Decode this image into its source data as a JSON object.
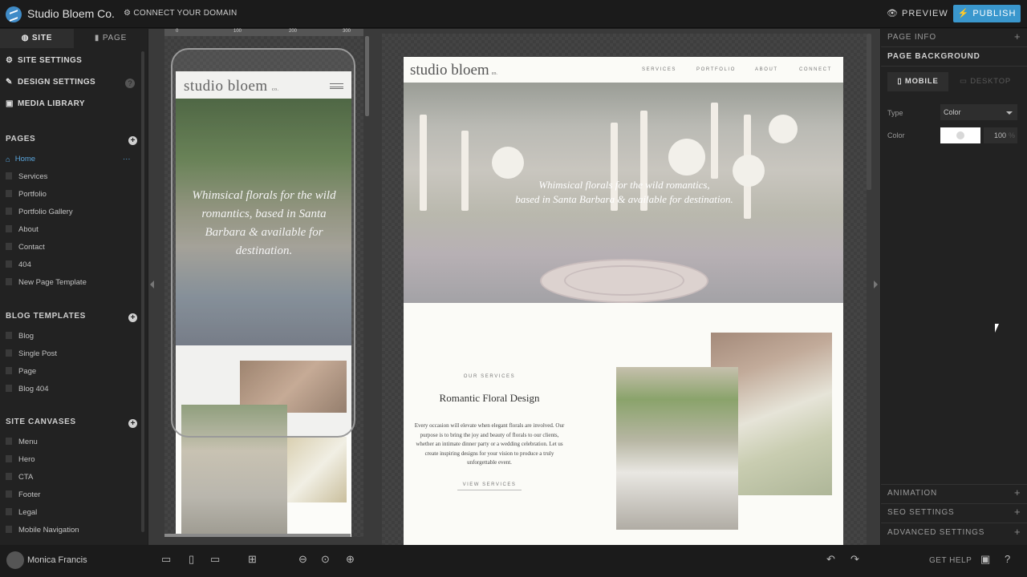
{
  "topbar": {
    "site_title": "Studio Bloem Co.",
    "connect_domain": "CONNECT YOUR DOMAIN",
    "preview": "PREVIEW",
    "publish": "PUBLISH"
  },
  "leftbar": {
    "tabs": [
      "SITE",
      "PAGE"
    ],
    "menu": [
      "SITE SETTINGS",
      "DESIGN SETTINGS",
      "MEDIA LIBRARY"
    ],
    "pages_header": "PAGES",
    "pages": [
      "Home",
      "Services",
      "Portfolio",
      "Portfolio Gallery",
      "About",
      "Contact",
      "404",
      "New Page Template"
    ],
    "blog_header": "BLOG TEMPLATES",
    "blog": [
      "Blog",
      "Single Post",
      "Page",
      "Blog 404"
    ],
    "canvases_header": "SITE CANVASES",
    "canvases": [
      "Menu",
      "Hero",
      "CTA",
      "Footer",
      "Legal",
      "Mobile Navigation"
    ]
  },
  "ruler": [
    "0",
    "100",
    "200",
    "300"
  ],
  "mobile": {
    "logo": "studio bloem",
    "logo_suffix": "co.",
    "hero_text": "Whimsical florals for the wild romantics, based in Santa Barbara & available for destination."
  },
  "desktop": {
    "logo": "studio bloem",
    "logo_suffix": "co.",
    "nav": [
      "SERVICES",
      "PORTFOLIO",
      "ABOUT",
      "CONNECT"
    ],
    "hero_line1": "Whimsical florals for the wild romantics,",
    "hero_line2": "based in Santa Barbara & available for destination.",
    "kicker": "OUR SERVICES",
    "heading": "Romantic Floral Design",
    "body": "Every occasion will elevate when elegant florals are involved. Our purpose is to bring the joy and beauty of florals to our clients, whether an intimate dinner party or a wedding celebration. Let us create inspiring designs for your vision to produce a truly unforgettable event.",
    "link": "VIEW SERVICES"
  },
  "rightbar": {
    "page_info": "PAGE INFO",
    "page_background": "PAGE BACKGROUND",
    "tab_mobile": "MOBILE",
    "tab_desktop": "DESKTOP",
    "type_label": "Type",
    "type_value": "Color",
    "color_label": "Color",
    "opacity_value": "100",
    "animation": "ANIMATION",
    "seo": "SEO SETTINGS",
    "advanced": "ADVANCED SETTINGS"
  },
  "bottombar": {
    "user": "Monica Francis",
    "get_help": "GET HELP"
  },
  "colors": {
    "accent": "#3a97cd",
    "active_page": "#5aa7df"
  }
}
